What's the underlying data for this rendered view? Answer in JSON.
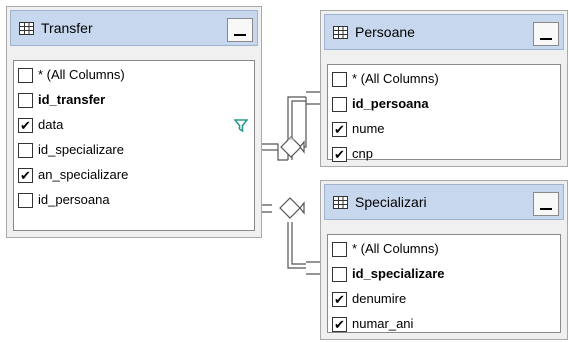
{
  "tables": {
    "transfer": {
      "title": "Transfer",
      "columns": [
        {
          "label": "* (All Columns)",
          "checked": false,
          "key": false
        },
        {
          "label": "id_transfer",
          "checked": false,
          "key": true
        },
        {
          "label": "data",
          "checked": true,
          "key": false,
          "filter": true
        },
        {
          "label": "id_specializare",
          "checked": false,
          "key": false
        },
        {
          "label": "an_specializare",
          "checked": true,
          "key": false
        },
        {
          "label": "id_persoana",
          "checked": false,
          "key": false
        }
      ]
    },
    "persoane": {
      "title": "Persoane",
      "columns": [
        {
          "label": "* (All Columns)",
          "checked": false,
          "key": false
        },
        {
          "label": "id_persoana",
          "checked": false,
          "key": true
        },
        {
          "label": "nume",
          "checked": true,
          "key": false
        },
        {
          "label": "cnp",
          "checked": true,
          "key": false
        }
      ]
    },
    "specializari": {
      "title": "Specializari",
      "columns": [
        {
          "label": "* (All Columns)",
          "checked": false,
          "key": false
        },
        {
          "label": "id_specializare",
          "checked": false,
          "key": true
        },
        {
          "label": "denumire",
          "checked": true,
          "key": false
        },
        {
          "label": "numar_ani",
          "checked": true,
          "key": false
        }
      ]
    }
  },
  "icons": {
    "table": "table-grid-icon",
    "minimize": "minimize-icon",
    "filter": "filter-funnel-icon",
    "check": "checkmark"
  },
  "colors": {
    "header": "#c7d8ee",
    "filter": "#2a9a8c",
    "relation_line": "#555555"
  }
}
